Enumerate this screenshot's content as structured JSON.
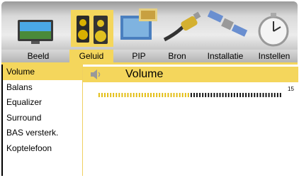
{
  "tabs": [
    {
      "label": "Beeld",
      "icon": "tv-icon",
      "active": false
    },
    {
      "label": "Geluid",
      "icon": "speakers-icon",
      "active": true
    },
    {
      "label": "PIP",
      "icon": "pip-icon",
      "active": false
    },
    {
      "label": "Bron",
      "icon": "cable-icon",
      "active": false
    },
    {
      "label": "Installatie",
      "icon": "satellite-icon",
      "active": false
    },
    {
      "label": "Instellen",
      "icon": "clock-icon",
      "active": false
    }
  ],
  "menu": {
    "items": [
      {
        "label": "Volume",
        "active": true
      },
      {
        "label": "Balans",
        "active": false
      },
      {
        "label": "Equalizer",
        "active": false
      },
      {
        "label": "Surround",
        "active": false
      },
      {
        "label": "BAS versterk.",
        "active": false
      },
      {
        "label": "Koptelefoon",
        "active": false
      }
    ]
  },
  "panel": {
    "title": "Volume",
    "icon": "speaker-icon",
    "slider_value": "15",
    "slider_fraction": 0.5
  },
  "colors": {
    "accent": "#f4d65c",
    "slider_inactive": "#e0b800",
    "slider_active": "#000000"
  }
}
